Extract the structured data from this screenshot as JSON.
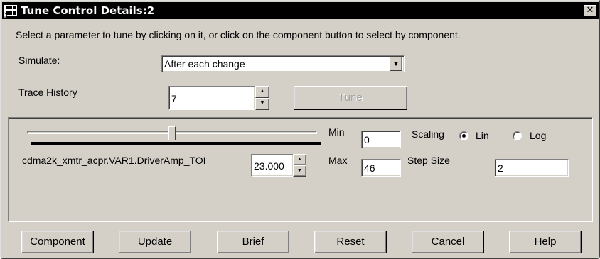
{
  "window": {
    "title": "Tune Control Details:2",
    "close_glyph": "✕"
  },
  "instructions": "Select a parameter to tune by clicking on it, or click on the component button to select by component.",
  "simulate": {
    "label": "Simulate:",
    "value": "After each change",
    "arrow": "▼"
  },
  "trace_history": {
    "label": "Trace History",
    "value": "7",
    "up": "▲",
    "down": "▼"
  },
  "tune_button": {
    "label": "Tune",
    "enabled": false
  },
  "parameter": {
    "name": "cdma2k_xmtr_acpr.VAR1.DriverAmp_TOI",
    "value": "23.000",
    "up": "▲",
    "down": "▼",
    "slider_fraction": 0.5
  },
  "range": {
    "min_label": "Min",
    "min_value": "0",
    "max_label": "Max",
    "max_value": "46"
  },
  "scaling": {
    "label": "Scaling",
    "options": [
      "Lin",
      "Log"
    ],
    "selected": "Lin"
  },
  "step_size": {
    "label": "Step Size",
    "value": "2"
  },
  "buttons": {
    "component": "Component",
    "update": "Update",
    "brief": "Brief",
    "reset": "Reset",
    "cancel": "Cancel",
    "help": "Help"
  },
  "icons": {
    "app": "app-icon",
    "close": "close-icon",
    "dropdown": "chevron-down-icon",
    "spin_up": "spin-up-icon",
    "spin_down": "spin-down-icon"
  },
  "colors": {
    "face": "#d4d0c8",
    "titlebar": "#000000",
    "disabled_text": "#a0a0a0"
  }
}
